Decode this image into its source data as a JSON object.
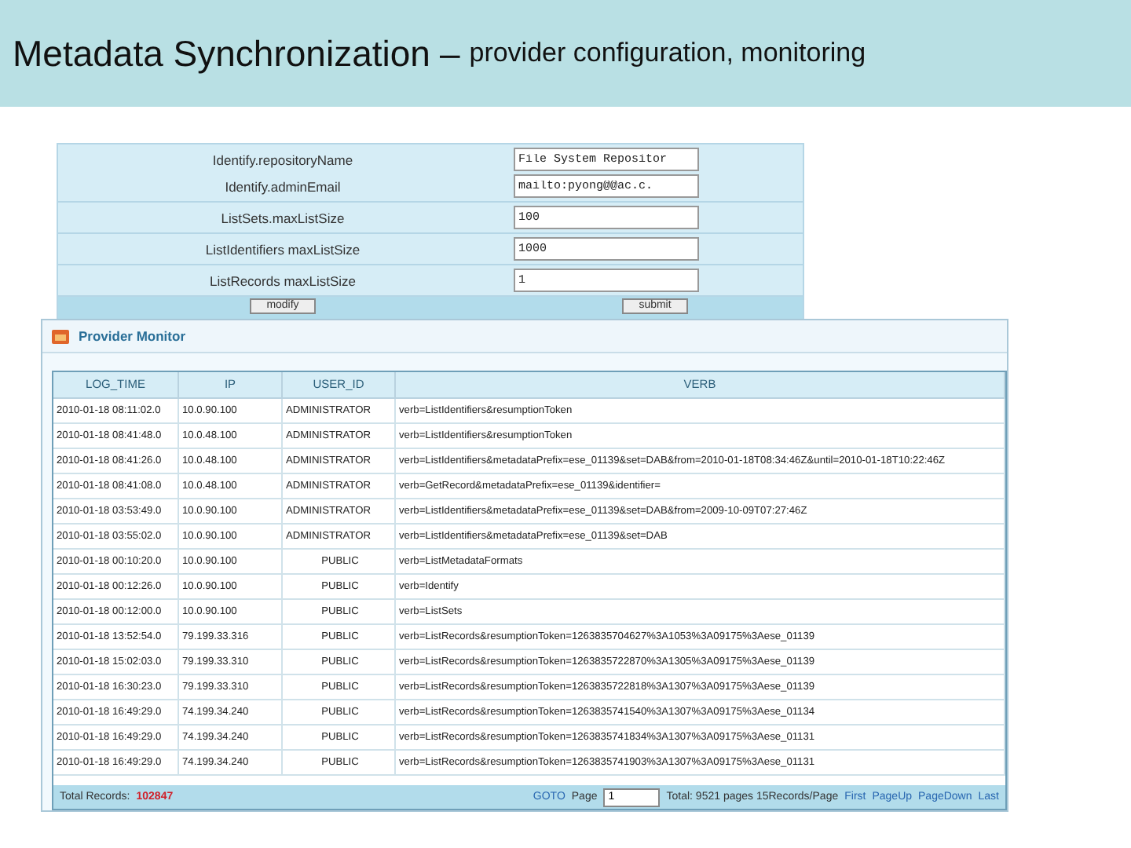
{
  "slide_title": {
    "main": "Metadata Synchronization",
    "dash": "–",
    "subtitle": "provider configuration, monitoring"
  },
  "config_form": {
    "field_groups": [
      [
        {
          "label": "Identify.repositoryName",
          "value": "File System Repositor"
        },
        {
          "label": "Identify.adminEmail",
          "value": "mailto:pyong@@ac.c."
        }
      ],
      [
        {
          "label": "ListSets.maxListSize",
          "value": "100"
        }
      ],
      [
        {
          "label": "ListIdentifiers maxListSize",
          "value": "1000"
        }
      ],
      [
        {
          "label": "ListRecords maxListSize",
          "value": "1"
        }
      ]
    ],
    "buttons": [
      "modify",
      "submit"
    ]
  },
  "monitor": {
    "title": "Provider Monitor",
    "columns": [
      "LOG_TIME",
      "IP",
      "USER_ID",
      "VERB"
    ],
    "rows": [
      [
        "2010-01-18 08:11:02.0",
        "10.0.90.100",
        "ADMINISTRATOR",
        "verb=ListIdentifiers&resumptionToken"
      ],
      [
        "2010-01-18 08:41:48.0",
        "10.0.48.100",
        "ADMINISTRATOR",
        "verb=ListIdentifiers&resumptionToken"
      ],
      [
        "2010-01-18 08:41:26.0",
        "10.0.48.100",
        "ADMINISTRATOR",
        "verb=ListIdentifiers&metadataPrefix=ese_01139&set=DAB&from=2010-01-18T08:34:46Z&until=2010-01-18T10:22:46Z"
      ],
      [
        "2010-01-18 08:41:08.0",
        "10.0.48.100",
        "ADMINISTRATOR",
        "verb=GetRecord&metadataPrefix=ese_01139&identifier="
      ],
      [
        "2010-01-18 03:53:49.0",
        "10.0.90.100",
        "ADMINISTRATOR",
        "verb=ListIdentifiers&metadataPrefix=ese_01139&set=DAB&from=2009-10-09T07:27:46Z"
      ],
      [
        "2010-01-18 03:55:02.0",
        "10.0.90.100",
        "ADMINISTRATOR",
        "verb=ListIdentifiers&metadataPrefix=ese_01139&set=DAB"
      ],
      [
        "2010-01-18 00:10:20.0",
        "10.0.90.100",
        "PUBLIC",
        "verb=ListMetadataFormats"
      ],
      [
        "2010-01-18 00:12:26.0",
        "10.0.90.100",
        "PUBLIC",
        "verb=Identify"
      ],
      [
        "2010-01-18 00:12:00.0",
        "10.0.90.100",
        "PUBLIC",
        "verb=ListSets"
      ],
      [
        "2010-01-18 13:52:54.0",
        "79.199.33.316",
        "PUBLIC",
        "verb=ListRecords&resumptionToken=1263835704627%3A1053%3A09175%3Aese_01139"
      ],
      [
        "2010-01-18 15:02:03.0",
        "79.199.33.310",
        "PUBLIC",
        "verb=ListRecords&resumptionToken=1263835722870%3A1305%3A09175%3Aese_01139"
      ],
      [
        "2010-01-18 16:30:23.0",
        "79.199.33.310",
        "PUBLIC",
        "verb=ListRecords&resumptionToken=1263835722818%3A1307%3A09175%3Aese_01139"
      ],
      [
        "2010-01-18 16:49:29.0",
        "74.199.34.240",
        "PUBLIC",
        "verb=ListRecords&resumptionToken=1263835741540%3A1307%3A09175%3Aese_01134"
      ],
      [
        "2010-01-18 16:49:29.0",
        "74.199.34.240",
        "PUBLIC",
        "verb=ListRecords&resumptionToken=1263835741834%3A1307%3A09175%3Aese_01131"
      ],
      [
        "2010-01-18 16:49:29.0",
        "74.199.34.240",
        "PUBLIC",
        "verb=ListRecords&resumptionToken=1263835741903%3A1307%3A09175%3Aese_01131"
      ]
    ],
    "footer": {
      "total_label": "Total Records:",
      "total_value": "102847",
      "goto": "GOTO",
      "page_label": "Page",
      "page_value": "1",
      "summary": "Total: 9521 pages  15Records/Page",
      "links": [
        "First",
        "PageUp",
        "PageDown",
        "Last"
      ]
    }
  }
}
